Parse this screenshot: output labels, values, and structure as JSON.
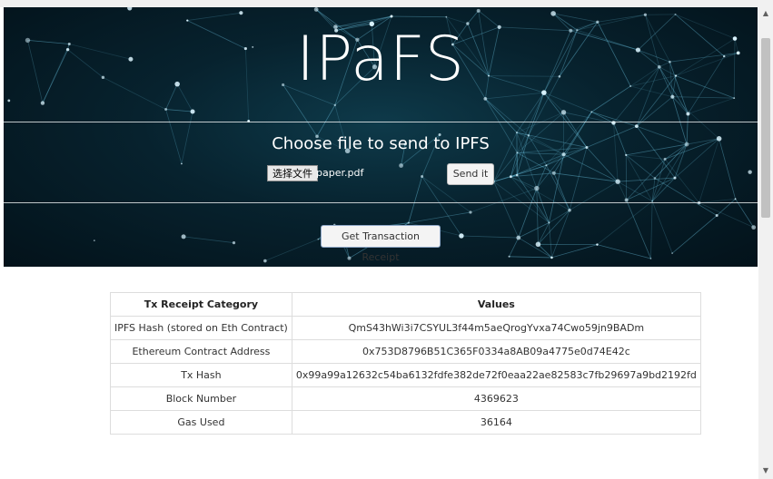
{
  "hero": {
    "title": "IPaFS",
    "subtitle": "Choose file to send to IPFS",
    "file_button_label": "选择文件",
    "file_name": "paper.pdf",
    "send_button_label": "Send it",
    "receipt_button_label": "Get Transaction Receipt"
  },
  "receipt_table": {
    "headers": [
      "Tx Receipt Category",
      "Values"
    ],
    "rows": [
      {
        "category": "IPFS Hash (stored on Eth Contract)",
        "value": "QmS43hWi3i7CSYUL3f44m5aeQrogYvxa74Cwo59jn9BADm"
      },
      {
        "category": "Ethereum Contract Address",
        "value": "0x753D8796B51C365F0334a8AB09a4775e0d74E42c"
      },
      {
        "category": "Tx Hash",
        "value": "0x99a99a12632c54ba6132fdfe382de72f0eaa22ae82583c7fb29697a9bd2192fd"
      },
      {
        "category": "Block Number",
        "value": "4369623"
      },
      {
        "category": "Gas Used",
        "value": "36164"
      }
    ]
  },
  "scrollbar": {
    "up_icon": "triangle-up-icon",
    "down_icon": "triangle-down-icon"
  }
}
